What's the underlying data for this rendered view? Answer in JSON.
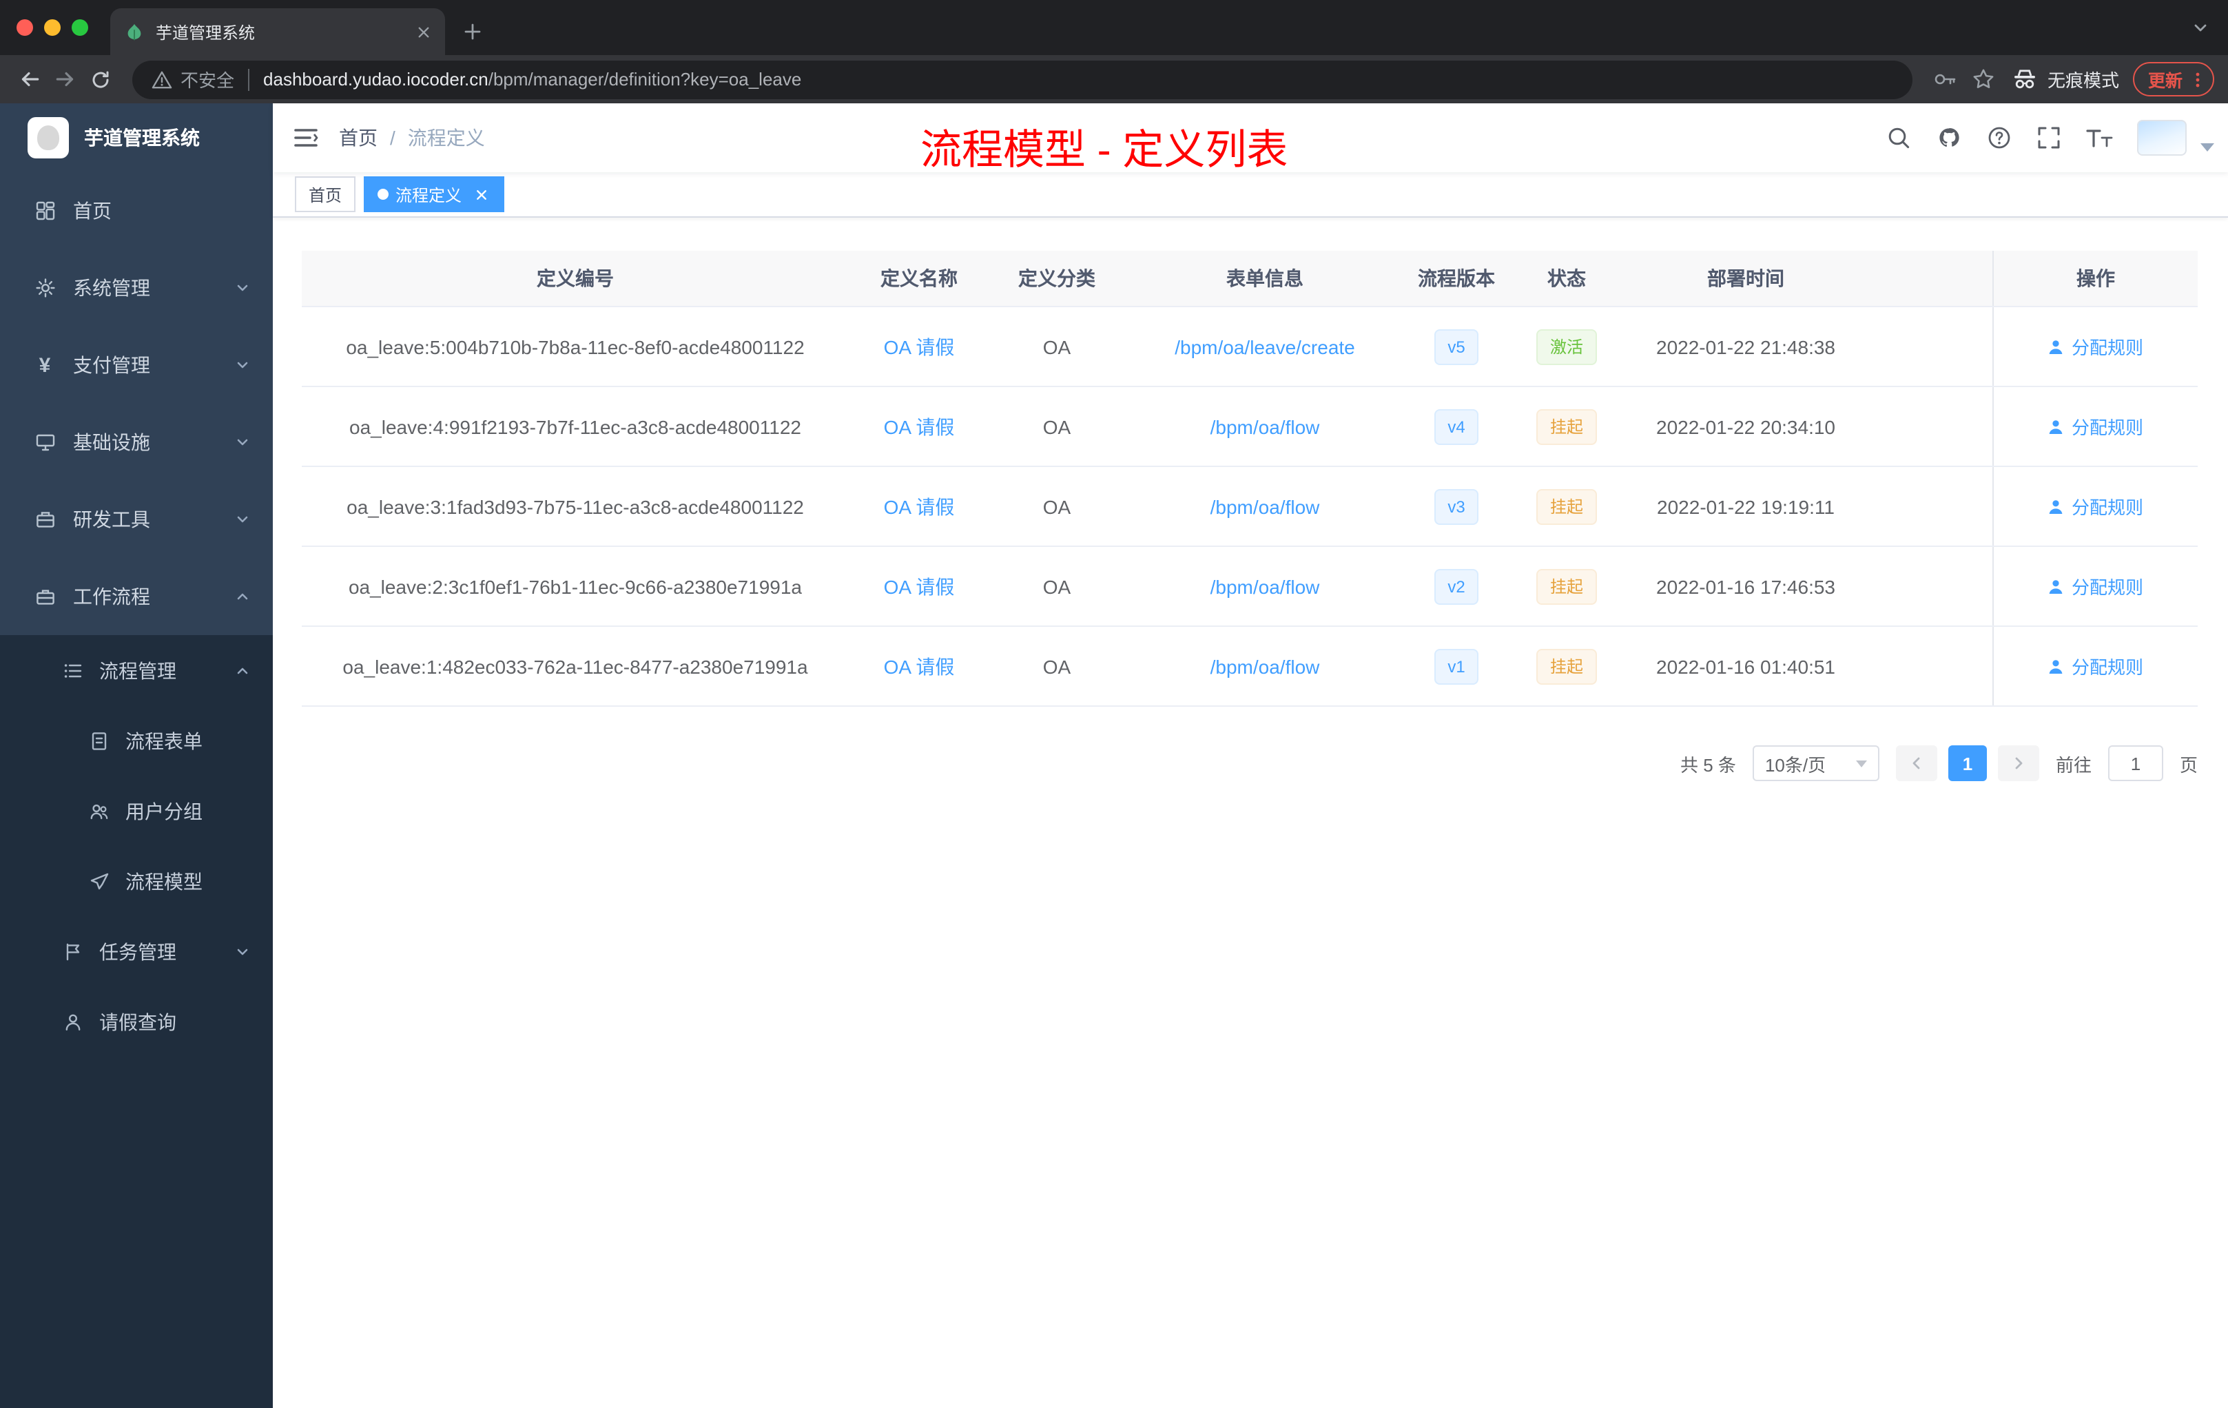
{
  "browser": {
    "tab_title": "芋道管理系统",
    "security_label": "不安全",
    "url_domain": "dashboard.yudao.iocoder.cn",
    "url_path": "/bpm/manager/definition?key=oa_leave",
    "incognito_label": "无痕模式",
    "update_label": "更新"
  },
  "sidebar": {
    "brand": "芋道管理系统",
    "items": [
      {
        "label": "首页"
      },
      {
        "label": "系统管理"
      },
      {
        "label": "支付管理"
      },
      {
        "label": "基础设施"
      },
      {
        "label": "研发工具"
      },
      {
        "label": "工作流程"
      }
    ],
    "submenu": {
      "process_management": {
        "label": "流程管理"
      },
      "children": [
        {
          "label": "流程表单"
        },
        {
          "label": "用户分组"
        },
        {
          "label": "流程模型"
        }
      ],
      "task_management": {
        "label": "任务管理"
      },
      "leave_query": {
        "label": "请假查询"
      }
    }
  },
  "header": {
    "breadcrumb_home": "首页",
    "breadcrumb_separator": "/",
    "breadcrumb_current": "流程定义",
    "annotation": "流程模型 - 定义列表"
  },
  "tags": {
    "home": "首页",
    "active": "流程定义"
  },
  "table": {
    "columns": [
      "定义编号",
      "定义名称",
      "定义分类",
      "表单信息",
      "流程版本",
      "状态",
      "部署时间",
      "操作"
    ],
    "rows": [
      {
        "id": "oa_leave:5:004b710b-7b8a-11ec-8ef0-acde48001122",
        "name": "OA 请假",
        "category": "OA",
        "form": "/bpm/oa/leave/create",
        "version": "v5",
        "status": "激活",
        "deployed": "2022-01-22 21:48:38",
        "action": "分配规则"
      },
      {
        "id": "oa_leave:4:991f2193-7b7f-11ec-a3c8-acde48001122",
        "name": "OA 请假",
        "category": "OA",
        "form": "/bpm/oa/flow",
        "version": "v4",
        "status": "挂起",
        "deployed": "2022-01-22 20:34:10",
        "action": "分配规则"
      },
      {
        "id": "oa_leave:3:1fad3d93-7b75-11ec-a3c8-acde48001122",
        "name": "OA 请假",
        "category": "OA",
        "form": "/bpm/oa/flow",
        "version": "v3",
        "status": "挂起",
        "deployed": "2022-01-22 19:19:11",
        "action": "分配规则"
      },
      {
        "id": "oa_leave:2:3c1f0ef1-76b1-11ec-9c66-a2380e71991a",
        "name": "OA 请假",
        "category": "OA",
        "form": "/bpm/oa/flow",
        "version": "v2",
        "status": "挂起",
        "deployed": "2022-01-16 17:46:53",
        "action": "分配规则"
      },
      {
        "id": "oa_leave:1:482ec033-762a-11ec-8477-a2380e71991a",
        "name": "OA 请假",
        "category": "OA",
        "form": "/bpm/oa/flow",
        "version": "v1",
        "status": "挂起",
        "deployed": "2022-01-16 01:40:51",
        "action": "分配规则"
      }
    ]
  },
  "pagination": {
    "total": "共 5 条",
    "page_size": "10条/页",
    "current_page": "1",
    "goto_label": "前往",
    "goto_value": "1",
    "unit": "页"
  },
  "colors": {
    "accent_blue": "#409eff",
    "status_active_green": "#67c23a",
    "status_suspended_orange": "#e6a23c",
    "annotation_red": "#ff0000",
    "sidebar_bg": "#304156",
    "submenu_bg": "#1f2d3d"
  }
}
